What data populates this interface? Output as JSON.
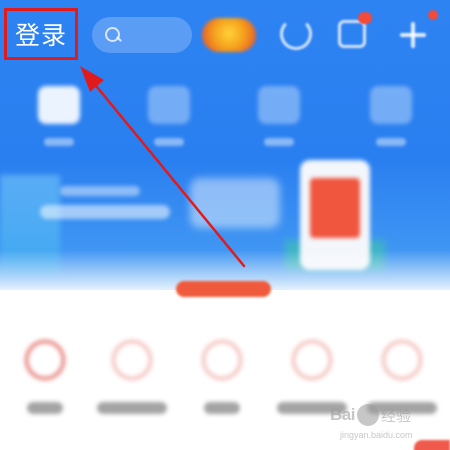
{
  "header": {
    "login_label": "登录",
    "login_highlight_color": "#e11b1b",
    "background_color": "#2e83f2"
  },
  "icons": {
    "search": "search-icon",
    "refresh": "refresh-icon",
    "message": "message-icon",
    "add": "plus-icon"
  },
  "annotation": {
    "arrow_color": "#e11b1b"
  },
  "watermark": {
    "brand": "Bai",
    "brand_suffix": "经验",
    "url": "jingyan.baidu.com"
  }
}
